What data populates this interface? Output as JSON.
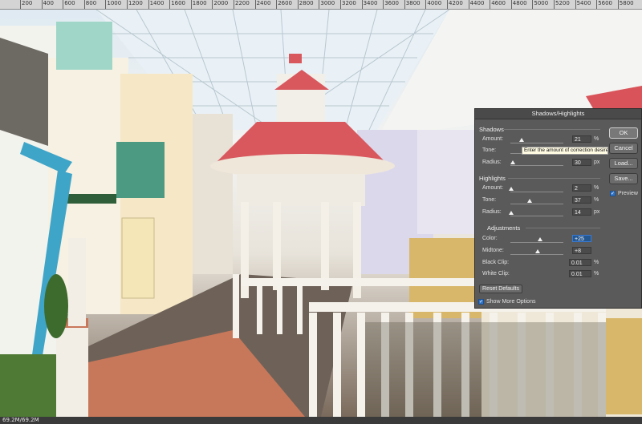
{
  "ruler": {
    "ticks": [
      "200",
      "400",
      "600",
      "800",
      "1000",
      "1200",
      "1400",
      "1600",
      "1800",
      "2000",
      "2200",
      "2400",
      "2600",
      "2800",
      "3000",
      "3200",
      "3400",
      "3600",
      "3800",
      "4000",
      "4200",
      "4400",
      "4600",
      "4800",
      "5000",
      "5200",
      "5400",
      "5600",
      "5800"
    ]
  },
  "status": {
    "doc_size": "69.2M/69.2M"
  },
  "dialog": {
    "title": "Shadows/Highlights",
    "shadows": {
      "heading": "Shadows",
      "amount": {
        "label": "Amount:",
        "value": "21",
        "unit": "%",
        "level": 0.21
      },
      "tone": {
        "label": "Tone:"
      },
      "radius": {
        "label": "Radius:",
        "value": "30",
        "unit": "px",
        "level": 0.05
      }
    },
    "tooltip": "Enter the amount of correction desired",
    "highlights": {
      "heading": "Highlights",
      "amount": {
        "label": "Amount:",
        "value": "2",
        "unit": "%",
        "level": 0.02
      },
      "tone": {
        "label": "Tone:",
        "value": "37",
        "unit": "%",
        "level": 0.37
      },
      "radius": {
        "label": "Radius:",
        "value": "14",
        "unit": "px",
        "level": 0.02
      }
    },
    "adjustments": {
      "heading": "Adjustments",
      "color": {
        "label": "Color:",
        "value": "+25",
        "level": 0.56
      },
      "midtone": {
        "label": "Midtone:",
        "value": "+8",
        "level": 0.52
      },
      "black_clip": {
        "label": "Black Clip:",
        "value": "0.01",
        "unit": "%"
      },
      "white_clip": {
        "label": "White Clip:",
        "value": "0.01",
        "unit": "%"
      }
    },
    "reset_label": "Reset Defaults",
    "show_more_label": "Show More Options",
    "buttons": {
      "ok": "OK",
      "cancel": "Cancel",
      "load": "Load...",
      "save": "Save..."
    },
    "preview_label": "Preview"
  }
}
